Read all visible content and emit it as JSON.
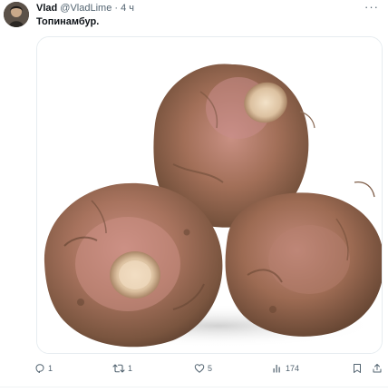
{
  "tweet": {
    "author": {
      "display_name": "Vlad",
      "handle": "@VladLime",
      "separator": "·",
      "time": "4 ч"
    },
    "more_label": "···",
    "text": "Топинамбур.",
    "media": {
      "icon": "jerusalem-artichoke-photo",
      "background": "#ffffff"
    },
    "actions": {
      "reply_count": "1",
      "retweet_count": "1",
      "like_count": "5",
      "views_count": "174"
    },
    "colors": {
      "text": "#0f1419",
      "secondary": "#536471",
      "border": "#e6ecf0"
    }
  }
}
